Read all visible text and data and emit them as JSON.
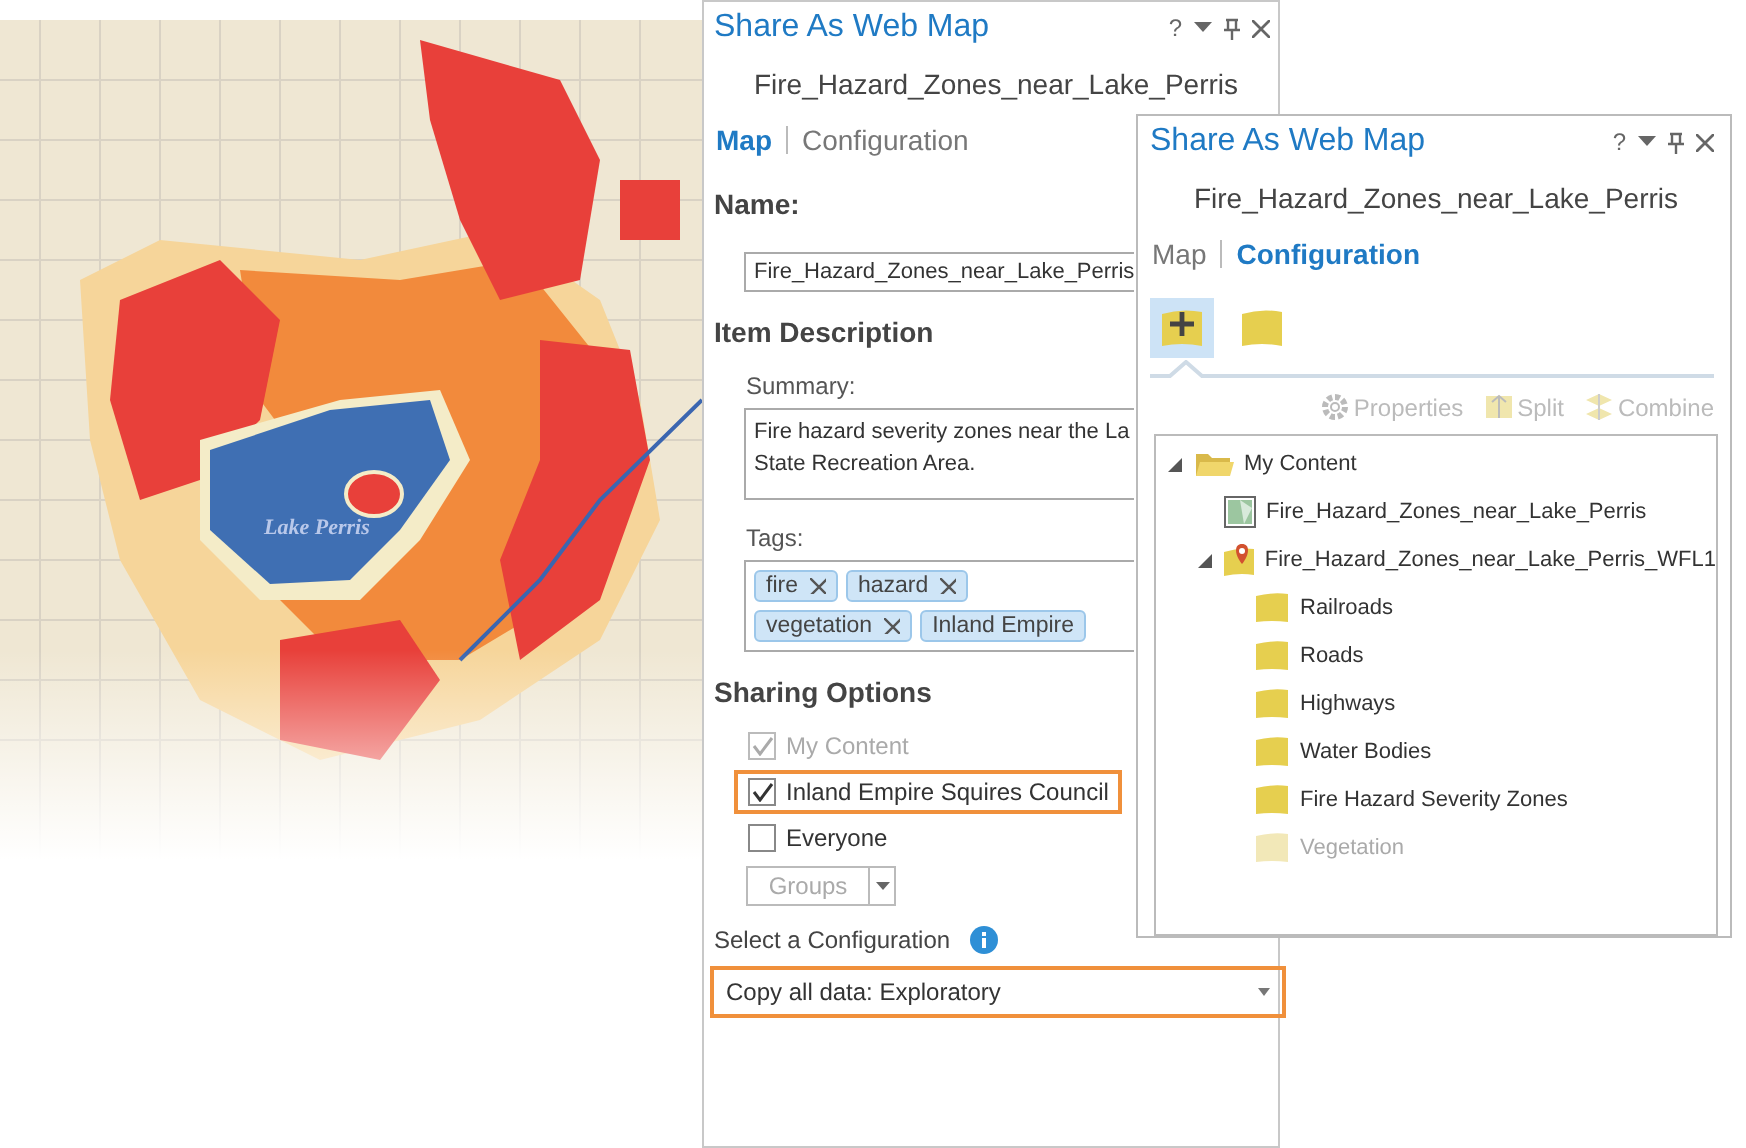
{
  "map": {
    "lake_label": "Lake Perris"
  },
  "panel_main": {
    "title": "Share As Web Map",
    "help": "?",
    "subtitle": "Fire_Hazard_Zones_near_Lake_Perris",
    "tabs": [
      {
        "label": "Map",
        "selected": true
      },
      {
        "label": "Configuration",
        "selected": false
      }
    ],
    "name_heading": "Name:",
    "name_value": "Fire_Hazard_Zones_near_Lake_Perris",
    "description_heading": "Item Description",
    "summary_label": "Summary:",
    "summary_lines": [
      "Fire hazard severity zones near the La",
      "State Recreation Area."
    ],
    "tags_label": "Tags:",
    "tags": [
      {
        "text": "fire",
        "removable": true
      },
      {
        "text": "hazard",
        "removable": true
      },
      {
        "text": "vegetation",
        "removable": true
      },
      {
        "text": "Inland Empire",
        "removable": false
      }
    ],
    "sharing_heading": "Sharing Options",
    "sharing_options": [
      {
        "label": "My Content",
        "checked": true,
        "disabled": true,
        "highlighted": false
      },
      {
        "label": "Inland Empire Squires Council",
        "checked": true,
        "disabled": false,
        "highlighted": true
      },
      {
        "label": "Everyone",
        "checked": false,
        "disabled": false,
        "highlighted": false
      }
    ],
    "groups_button": {
      "label": "Groups",
      "disabled": true
    },
    "configuration_label": "Select a Configuration",
    "configuration_select": {
      "value": "Copy all data: Exploratory",
      "highlighted": true
    }
  },
  "panel_config": {
    "title": "Share As Web Map",
    "help": "?",
    "subtitle": "Fire_Hazard_Zones_near_Lake_Perris",
    "tabs": [
      {
        "label": "Map",
        "selected": false
      },
      {
        "label": "Configuration",
        "selected": true
      }
    ],
    "layer_tools": [
      {
        "kind": "add",
        "selected": true
      },
      {
        "kind": "layer",
        "selected": false
      }
    ],
    "actions": [
      {
        "kind": "properties",
        "label": "Properties",
        "disabled": true
      },
      {
        "kind": "split",
        "label": "Split",
        "disabled": true
      },
      {
        "kind": "combine",
        "label": "Combine",
        "disabled": true
      }
    ],
    "tree": [
      {
        "kind": "folder",
        "label": "My Content",
        "expanded": true,
        "disabled": false,
        "children": [
          {
            "kind": "map",
            "label": "Fire_Hazard_Zones_near_Lake_Perris",
            "disabled": false
          },
          {
            "kind": "service",
            "label": "Fire_Hazard_Zones_near_Lake_Perris_WFL1",
            "expanded": true,
            "disabled": false,
            "children": [
              {
                "kind": "layer",
                "label": "Railroads",
                "disabled": false
              },
              {
                "kind": "layer",
                "label": "Roads",
                "disabled": false
              },
              {
                "kind": "layer",
                "label": "Highways",
                "disabled": false
              },
              {
                "kind": "layer",
                "label": "Water Bodies",
                "disabled": false
              },
              {
                "kind": "layer",
                "label": "Fire Hazard Severity Zones",
                "disabled": false
              },
              {
                "kind": "layer",
                "label": "Vegetation",
                "disabled": true
              }
            ]
          }
        ]
      }
    ]
  }
}
